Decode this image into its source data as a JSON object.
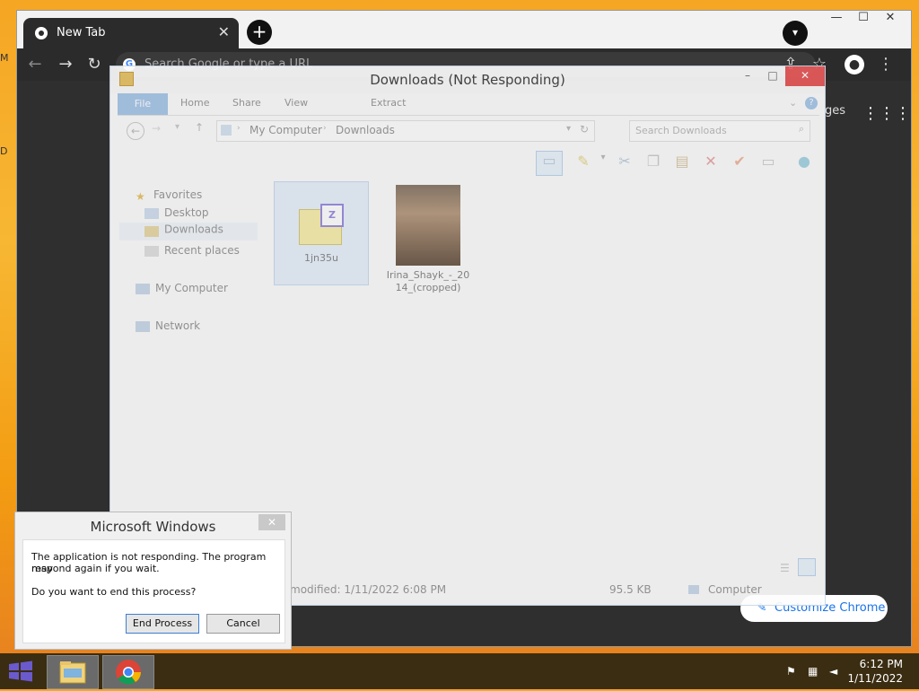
{
  "desktop": {
    "edge_letter_1": "M",
    "edge_letter_2": "D"
  },
  "chrome": {
    "tab_title": "New Tab",
    "tab_close": "✕",
    "new_tab": "+",
    "omnibox_placeholder": "Search Google or type a URL",
    "images_link": "ges",
    "customize_label": "Customize Chrome"
  },
  "explorer": {
    "title": "Downloads (Not Responding)",
    "ribbon": {
      "file": "File",
      "home": "Home",
      "share": "Share",
      "view": "View",
      "extract": "Extract"
    },
    "breadcrumb": {
      "root": "My Computer",
      "current": "Downloads"
    },
    "search_placeholder": "Search Downloads",
    "nav": {
      "favorites": "Favorites",
      "desktop": "Desktop",
      "downloads": "Downloads",
      "recent": "Recent places",
      "computer": "My Computer",
      "network": "Network"
    },
    "files": [
      {
        "name": "1jn35u"
      },
      {
        "name": "Irina_Shayk_-_2014_(cropped)"
      }
    ],
    "status": {
      "modified": "modified: 1/11/2022 6:08 PM",
      "size": "95.5 KB",
      "location": "Computer"
    }
  },
  "dialog": {
    "title": "Microsoft Windows",
    "line1": "The application is not responding. The program may",
    "line2": "respond again if you wait.",
    "question": "Do you want to end this process?",
    "end_process": "End Process",
    "cancel": "Cancel"
  },
  "taskbar": {
    "time": "6:12 PM",
    "date": "1/11/2022"
  },
  "colors": {
    "accent": "#1a73e8",
    "close_red": "#e85a5a",
    "taskbar": "#3b2d12"
  }
}
